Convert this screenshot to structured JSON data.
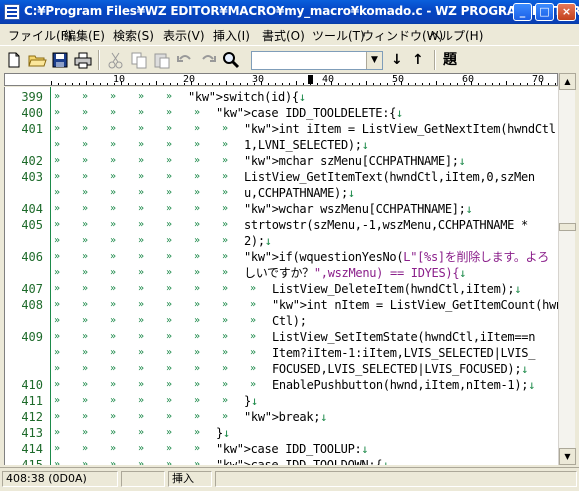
{
  "window": {
    "title": "C:¥Program Files¥WZ EDITOR¥MACRO¥my_macro¥komado.c - WZ PROGRAM EDITOR",
    "minimize": "_",
    "maximize": "□",
    "close": "×"
  },
  "menu": [
    "ファイル(F)",
    "編集(E)",
    "検索(S)",
    "表示(V)",
    "挿入(I)",
    "書式(O)",
    "ツール(T)",
    "ウィンドウ(W)",
    "ヘルプ(H)"
  ],
  "toolbar": {
    "combo_value": "",
    "combo_arrow": "▼",
    "down_arrow": "↓",
    "up_arrow": "↑",
    "title_button": "題"
  },
  "ruler": {
    "labels": [
      "10",
      "20",
      "30",
      "40",
      "50",
      "60",
      "70"
    ]
  },
  "editor": {
    "lines": [
      {
        "num": "399",
        "tabs": 5,
        "code": "switch(id){↓"
      },
      {
        "num": "400",
        "tabs": 6,
        "code": "case IDD_TOOLDELETE:{↓"
      },
      {
        "num": "401",
        "tabs": 7,
        "code": "int iItem = ListView_GetNextItem(hwndCtl,-"
      },
      {
        "num": "",
        "tabs": 7,
        "code": "1,LVNI_SELECTED);↓"
      },
      {
        "num": "402",
        "tabs": 7,
        "code": "mchar szMenu[CCHPATHNAME];↓"
      },
      {
        "num": "403",
        "tabs": 7,
        "code": "ListView_GetItemText(hwndCtl,iItem,0,szMen"
      },
      {
        "num": "",
        "tabs": 7,
        "code": "u,CCHPATHNAME);↓"
      },
      {
        "num": "404",
        "tabs": 7,
        "code": "wchar wszMenu[CCHPATHNAME];↓"
      },
      {
        "num": "405",
        "tabs": 7,
        "code": "strtowstr(szMenu,-1,wszMenu,CCHPATHNAME *"
      },
      {
        "num": "",
        "tabs": 7,
        "code": "2);↓"
      },
      {
        "num": "406",
        "tabs": 7,
        "code": "if(wquestionYesNo(L\"[%s]を削除します。よろ"
      },
      {
        "num": "",
        "tabs": 7,
        "code": "しいですか？\",wszMenu) == IDYES){↓"
      },
      {
        "num": "407",
        "tabs": 8,
        "code": "ListView_DeleteItem(hwndCtl,iItem);↓"
      },
      {
        "num": "408",
        "tabs": 8,
        "code": "int nItem = ListView_GetItemCount(hwnd"
      },
      {
        "num": "",
        "tabs": 8,
        "code": "Ctl);"
      },
      {
        "num": "409",
        "tabs": 8,
        "code": "ListView_SetItemState(hwndCtl,iItem==n"
      },
      {
        "num": "",
        "tabs": 8,
        "code": "Item?iItem-1:iItem,LVIS_SELECTED|LVIS_"
      },
      {
        "num": "",
        "tabs": 8,
        "code": "FOCUSED,LVIS_SELECTED|LVIS_FOCUSED);↓"
      },
      {
        "num": "410",
        "tabs": 8,
        "code": "EnablePushbutton(hwnd,iItem,nItem-1);↓"
      },
      {
        "num": "411",
        "tabs": 7,
        "code": "}↓"
      },
      {
        "num": "412",
        "tabs": 7,
        "code": "break;↓"
      },
      {
        "num": "413",
        "tabs": 6,
        "code": "}↓"
      },
      {
        "num": "414",
        "tabs": 6,
        "code": "case IDD_TOOLUP:↓"
      },
      {
        "num": "415",
        "tabs": 6,
        "code": "case IDD_TOOLDOWN:{↓"
      }
    ]
  },
  "status": {
    "position": "408:38 (0D0A)",
    "mode": "挿入"
  }
}
